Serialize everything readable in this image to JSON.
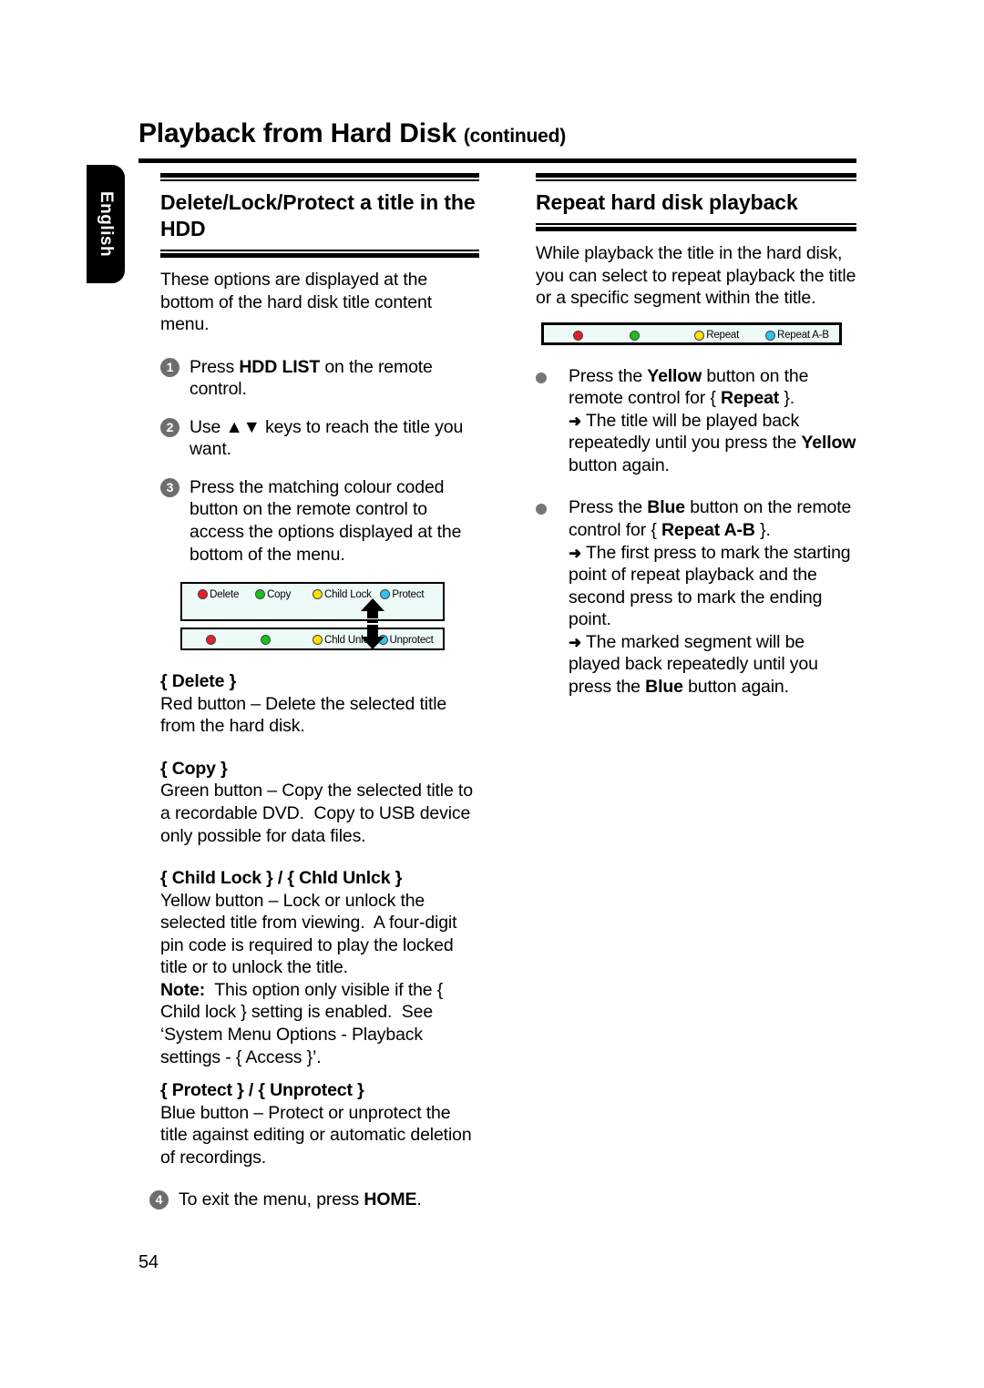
{
  "page": {
    "title_main": "Playback from Hard Disk",
    "title_continued": "(continued)",
    "language_tab": "English",
    "page_number": "54"
  },
  "left_column": {
    "section_heading": "Delete/Lock/Protect a title in the HDD",
    "intro": "These options are displayed at the bottom of the hard disk title content menu.",
    "steps": [
      {
        "num": "1",
        "html": "Press <b>HDD LIST</b> on the remote control."
      },
      {
        "num": "2",
        "html": "Use <b>▲▼</b> keys to reach the title you want."
      },
      {
        "num": "3",
        "html": "Press the matching colour coded button on the remote control to access the options displayed at the bottom of the menu."
      }
    ],
    "osd_menu": {
      "top_bar": [
        {
          "colour": "red",
          "label": "Delete"
        },
        {
          "colour": "green",
          "label": "Copy"
        },
        {
          "colour": "yellow",
          "label": "Child Lock"
        },
        {
          "colour": "blue",
          "label": "Protect"
        }
      ],
      "bottom_bar": [
        {
          "colour": "red",
          "label": ""
        },
        {
          "colour": "green",
          "label": ""
        },
        {
          "colour": "yellow",
          "label": "Chld Unlck"
        },
        {
          "colour": "blue",
          "label": "Unprotect"
        }
      ]
    },
    "options": [
      {
        "title_html": "{ <b>Delete</b> }",
        "body_html": "Red button – Delete the selected title from the hard disk."
      },
      {
        "title_html": "{ <b>Copy</b> }",
        "body_html": "Green button – Copy the selected title to a recordable DVD.&nbsp; Copy to USB device only possible for data files."
      },
      {
        "title_html": "{ <b>Child Lock</b> } / { <b>Chld Unlck</b> }",
        "body_html": "Yellow button – Lock or unlock the selected title from viewing.&nbsp; A four-digit pin code is required to play the locked title or to unlock the title.<br><b>Note:</b>&nbsp; This option only visible if the { Child lock } setting is enabled.&nbsp; See ‘System Menu Options - Playback settings - { Access }’."
      },
      {
        "title_html": "{ <b>Protect</b> } / { <b>Unprotect</b> }",
        "body_html": "Blue button – Protect or unprotect the title against editing or automatic deletion of recordings."
      }
    ],
    "final_step": {
      "num": "4",
      "html": "To exit the menu, press <b>HOME</b>."
    }
  },
  "right_column": {
    "section_heading": "Repeat hard disk playback",
    "intro": "While playback the title in the hard disk, you can select to repeat playback the title or a specific segment within the title.",
    "osd_repeat_bar": [
      {
        "colour": "red",
        "label": ""
      },
      {
        "colour": "green",
        "label": ""
      },
      {
        "colour": "yellow",
        "label": "Repeat"
      },
      {
        "colour": "blue",
        "label": "Repeat A-B"
      }
    ],
    "bullets": [
      {
        "main_html": "Press the <b>Yellow</b> button on the remote control for { <b>Repeat</b> }.",
        "arrows_html": [
          "The title will be played back repeatedly until you press the <b>Yellow</b> button again."
        ]
      },
      {
        "main_html": "Press the <b>Blue</b> button on the remote control for { <b>Repeat A-B</b> }.",
        "arrows_html": [
          "The first press to mark the starting point of repeat playback and the second press to mark the ending point.",
          "The marked segment will be played back repeatedly until you press the <b>Blue</b> button again."
        ]
      }
    ]
  },
  "colors": {
    "red": "#e81e25",
    "green": "#19c219",
    "yellow": "#ffe000",
    "blue": "#2fc3ee",
    "osd_background": "#eefaf8",
    "step_marker": "#6e6e6e"
  }
}
